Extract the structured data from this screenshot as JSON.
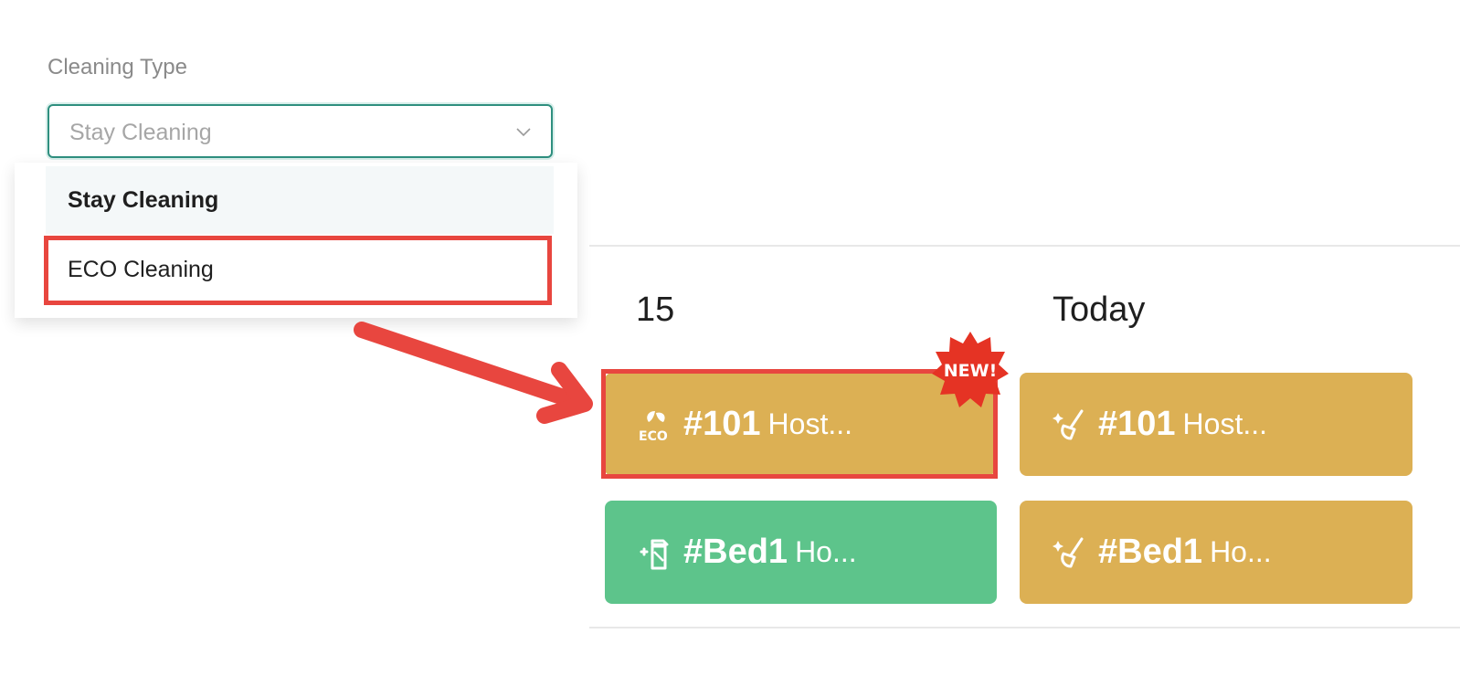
{
  "filter": {
    "label": "Cleaning Type",
    "select_value": "Stay Cleaning",
    "options": [
      {
        "label": "Stay Cleaning",
        "selected": true
      },
      {
        "label": "ECO Cleaning",
        "selected": false
      }
    ]
  },
  "calendar": {
    "days": [
      {
        "header": "15"
      },
      {
        "header": "Today"
      }
    ],
    "cards": [
      {
        "day": "15",
        "icon": "eco-leaf-icon",
        "room": "#101",
        "host": "Host...",
        "color": "#dcb054",
        "badge": "NEW!"
      },
      {
        "day": "Today",
        "icon": "broom-sparkle-icon",
        "room": "#101",
        "host": "Host...",
        "color": "#dcb054"
      },
      {
        "day": "15",
        "icon": "spray-bottle-icon",
        "room": "#Bed1",
        "host": "Ho...",
        "color": "#5dc48b"
      },
      {
        "day": "Today",
        "icon": "broom-sparkle-icon",
        "room": "#Bed1",
        "host": "Ho...",
        "color": "#dcb054"
      }
    ]
  },
  "annotations": {
    "highlight_color": "#e8463f",
    "badge_color": "#e53324"
  }
}
